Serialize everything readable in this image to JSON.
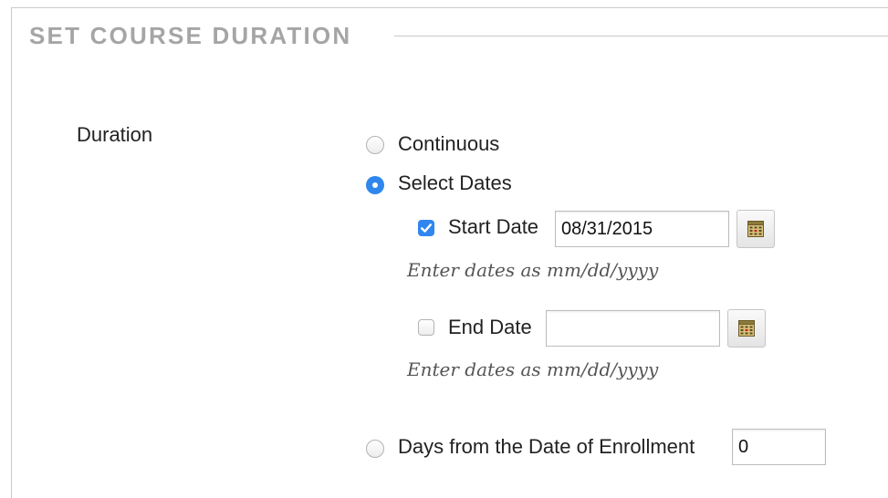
{
  "section": {
    "title": "SET COURSE DURATION"
  },
  "duration": {
    "label": "Duration",
    "options": [
      {
        "label": "Continuous",
        "selected": false
      },
      {
        "label": "Select Dates",
        "selected": true
      },
      {
        "label": "Days from the Date of Enrollment",
        "selected": false
      }
    ],
    "start_date": {
      "label": "Start Date",
      "checked": true,
      "value": "08/31/2015",
      "hint": "Enter dates as mm/dd/yyyy"
    },
    "end_date": {
      "label": "End Date",
      "checked": false,
      "value": "",
      "hint": "Enter dates as mm/dd/yyyy"
    },
    "days_from_enrollment": {
      "value": "0"
    }
  },
  "colors": {
    "accent": "#2f87ee",
    "title_gray": "#a5a5a5",
    "rule_gray": "#c9c9c9"
  },
  "icons": {
    "calendar": "calendar-icon",
    "check": "check-icon"
  }
}
